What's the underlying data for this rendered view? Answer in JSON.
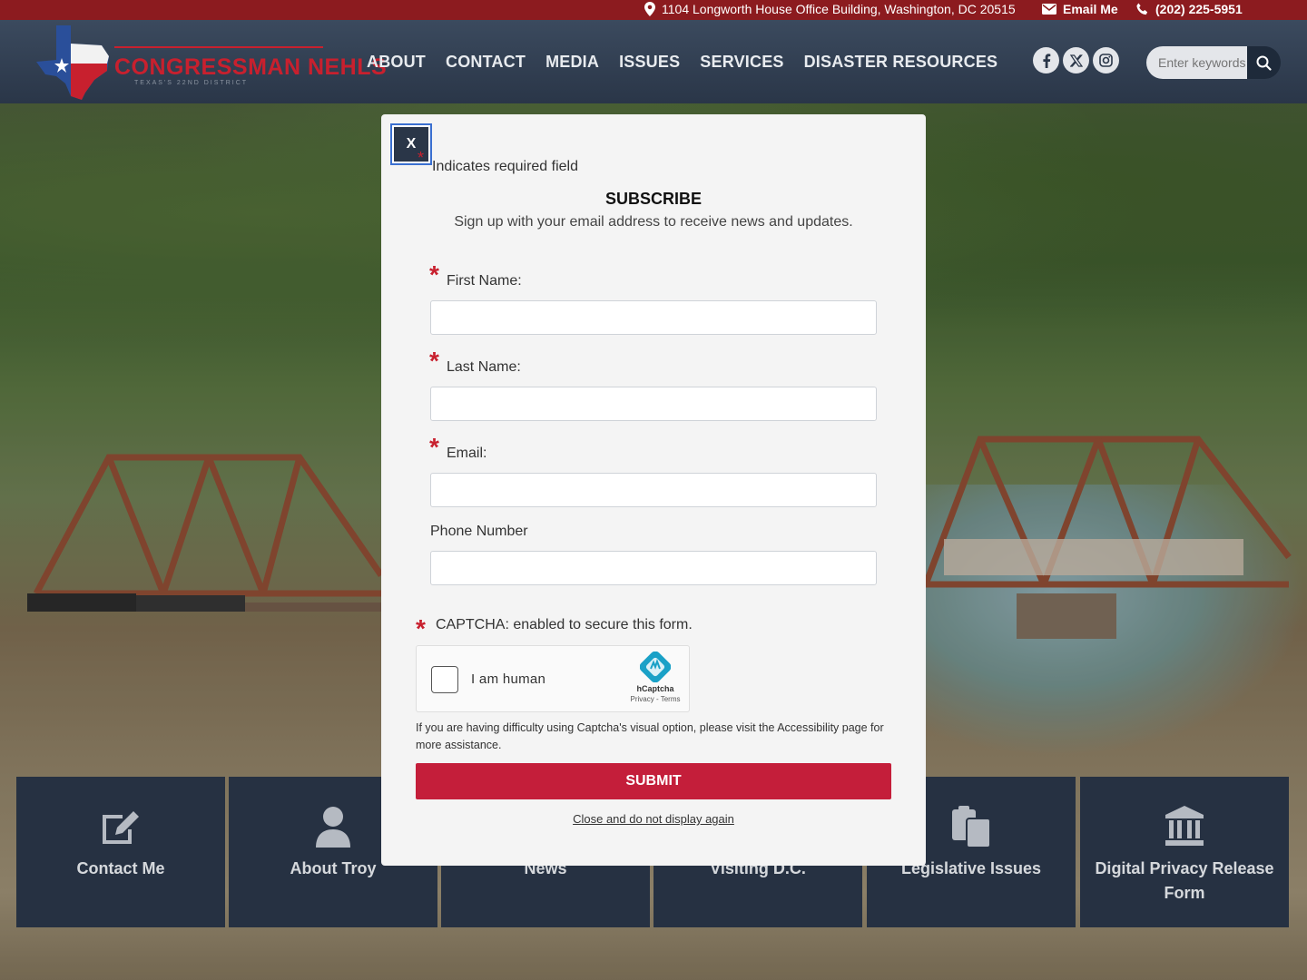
{
  "topbar": {
    "address": "1104 Longworth House Office Building, Washington, DC 20515",
    "email_label": "Email Me",
    "phone": "(202) 225-5951"
  },
  "header": {
    "logo_text": "CONGRESSMAN NEHLS",
    "logo_subtext": "TEXAS'S 22ND DISTRICT",
    "nav": [
      "ABOUT",
      "CONTACT",
      "MEDIA",
      "ISSUES",
      "SERVICES",
      "DISASTER RESOURCES"
    ],
    "social": [
      "facebook-icon",
      "x-icon",
      "instagram-icon"
    ],
    "search_placeholder": "Enter keywords"
  },
  "tiles": [
    {
      "label": "Contact Me",
      "icon": "edit-icon"
    },
    {
      "label": "About Troy",
      "icon": "user-icon"
    },
    {
      "label": "News",
      "icon": "newspaper-icon"
    },
    {
      "label": "Visiting D.C.",
      "icon": "capitol-icon"
    },
    {
      "label": "Legislative Issues",
      "icon": "clipboard-icon"
    },
    {
      "label": "Digital Privacy Release Form",
      "icon": "institution-icon"
    }
  ],
  "modal": {
    "close_label": "X",
    "required_note": "Indicates required field",
    "title": "SUBSCRIBE",
    "subtitle": "Sign up with your email address to receive news and updates.",
    "fields": [
      {
        "label": "First Name:",
        "required": true,
        "value": ""
      },
      {
        "label": "Last Name:",
        "required": true,
        "value": ""
      },
      {
        "label": "Email:",
        "required": true,
        "value": ""
      },
      {
        "label": "Phone Number",
        "required": false,
        "value": ""
      }
    ],
    "captcha_label": "CAPTCHA: enabled to secure this form.",
    "captcha_checkbox_label": "I am human",
    "captcha_brand": "hCaptcha",
    "captcha_links": "Privacy - Terms",
    "captcha_help": "If you are having difficulty using Captcha's visual option, please visit the Accessibility page for more assistance.",
    "submit_label": "SUBMIT",
    "dismiss_label": "Close and do not display again"
  },
  "colors": {
    "topbar_bg": "#8c1b1f",
    "header_bg": "#2a3648",
    "accent_red": "#c41e3a",
    "tile_bg": "#2a3648"
  }
}
